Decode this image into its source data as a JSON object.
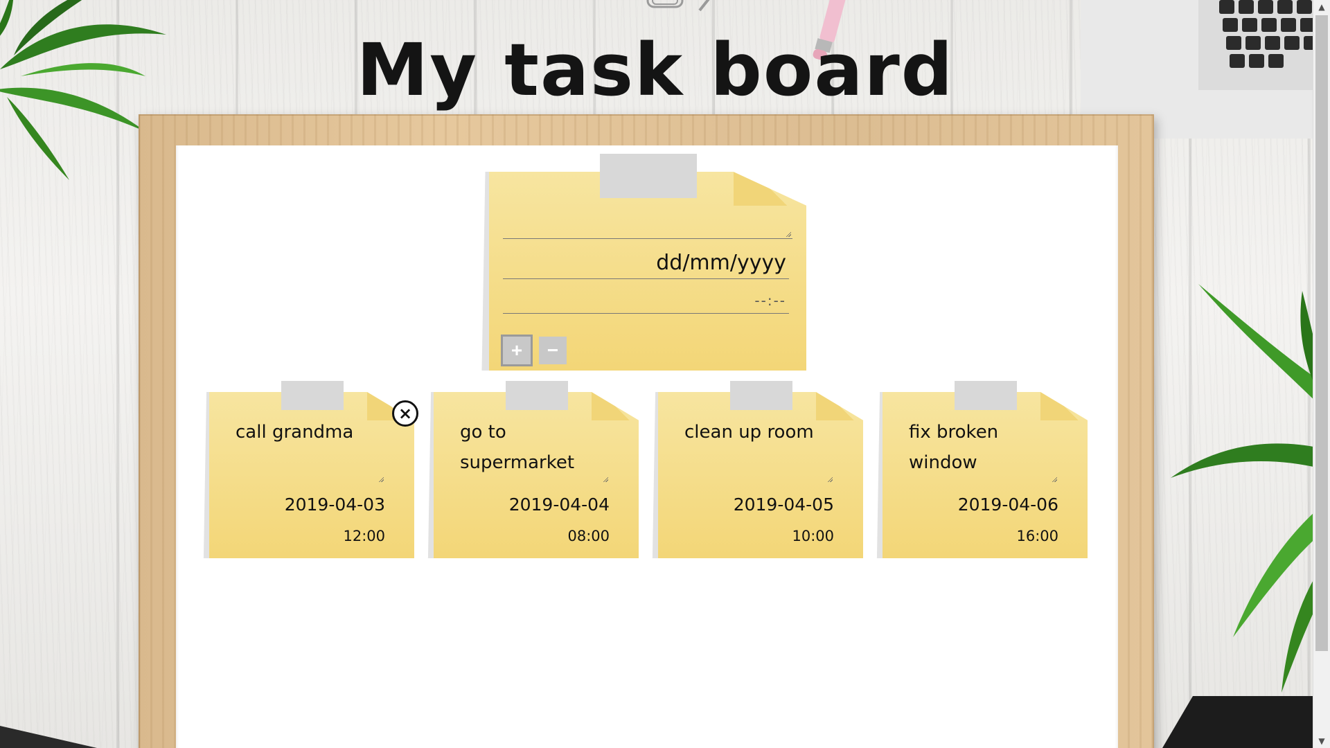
{
  "page": {
    "title": "My task board"
  },
  "form": {
    "date_placeholder": "dd/mm/yyyy",
    "time_placeholder": "--:--",
    "add_label": "+",
    "remove_label": "−"
  },
  "tasks": [
    {
      "text": "call grandma",
      "date": "2019-04-03",
      "time": "12:00"
    },
    {
      "text": "go to supermarket",
      "date": "2019-04-04",
      "time": "08:00"
    },
    {
      "text": "clean up room",
      "date": "2019-04-05",
      "time": "10:00"
    },
    {
      "text": "fix broken window",
      "date": "2019-04-06",
      "time": "16:00"
    }
  ],
  "icons": {
    "close": "×"
  },
  "colors": {
    "note_top": "#f7e5a0",
    "note_bottom": "#f3d677",
    "frame": "#e0c292",
    "tape": "#d8d8d8",
    "button": "#c8c8c8"
  }
}
